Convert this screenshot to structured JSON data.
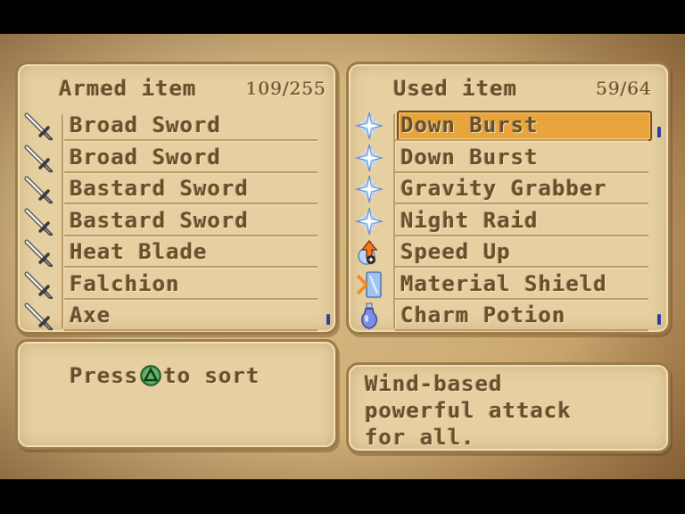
{
  "armed_panel": {
    "title": "Armed item",
    "count": "109/255",
    "items": [
      {
        "label": "Broad Sword",
        "icon": "sword-icon"
      },
      {
        "label": "Broad Sword",
        "icon": "sword-icon"
      },
      {
        "label": "Bastard Sword",
        "icon": "sword-icon"
      },
      {
        "label": "Bastard Sword",
        "icon": "sword-icon"
      },
      {
        "label": "Heat Blade",
        "icon": "sword-icon"
      },
      {
        "label": "Falchion",
        "icon": "sword-icon"
      },
      {
        "label": "Axe",
        "icon": "sword-icon"
      }
    ]
  },
  "used_panel": {
    "title": "Used item",
    "count": "59/64",
    "items": [
      {
        "label": "Down Burst",
        "icon": "spark-icon",
        "selected": true
      },
      {
        "label": "Down Burst",
        "icon": "spark-icon"
      },
      {
        "label": "Gravity Grabber",
        "icon": "spark-icon"
      },
      {
        "label": "Night Raid",
        "icon": "spark-icon"
      },
      {
        "label": "Speed Up",
        "icon": "speed-up-icon"
      },
      {
        "label": "Material Shield",
        "icon": "shield-icon"
      },
      {
        "label": "Charm Potion",
        "icon": "potion-icon"
      }
    ]
  },
  "hint": {
    "before": "Press",
    "button_icon": "triangle-button-icon",
    "after": "to sort"
  },
  "description": {
    "lines": [
      "Wind-based",
      "powerful attack",
      "for all."
    ]
  },
  "colors": {
    "cursor": "#e7a53c",
    "text": "#6a4e2c",
    "scroll_mark": "#2a3e9a"
  }
}
